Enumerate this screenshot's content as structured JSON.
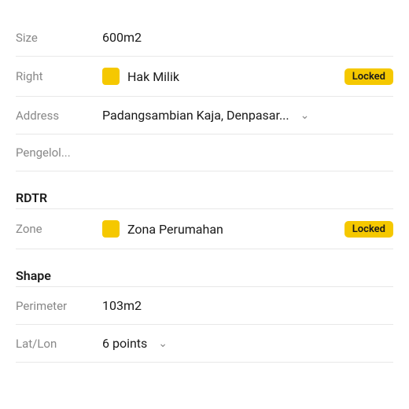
{
  "rows": [
    {
      "id": "size",
      "label": "Size",
      "value": "600m2",
      "type": "text"
    },
    {
      "id": "right",
      "label": "Right",
      "value": "Hak Milik",
      "type": "swatch-locked",
      "swatchColor": "#f5c800",
      "badge": "Locked"
    },
    {
      "id": "address",
      "label": "Address",
      "value": "Padangsambian Kaja, Denpasar...",
      "type": "dropdown"
    },
    {
      "id": "pengelol",
      "label": "Pengelol...",
      "value": "",
      "type": "text"
    }
  ],
  "sections": [
    {
      "id": "rdtr",
      "title": "RDTR",
      "rows": [
        {
          "id": "zone",
          "label": "Zone",
          "value": "Zona Perumahan",
          "type": "swatch-locked",
          "swatchColor": "#f5c800",
          "badge": "Locked"
        }
      ]
    },
    {
      "id": "shape",
      "title": "Shape",
      "rows": [
        {
          "id": "perimeter",
          "label": "Perimeter",
          "value": "103m2",
          "type": "text"
        },
        {
          "id": "latlon",
          "label": "Lat/Lon",
          "value": "6 points",
          "type": "dropdown"
        }
      ]
    }
  ]
}
